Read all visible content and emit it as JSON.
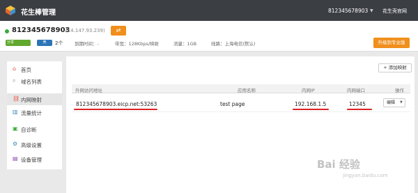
{
  "header": {
    "app_title": "花生棒管理",
    "user_id": "812345678903",
    "caret": "▼",
    "site_link": "花生壳官网"
  },
  "device": {
    "domain": "812345678903",
    "ip": "(14.147.93.239)",
    "swap_glyph": "⇄",
    "badge_green": "分享",
    "badge_blue": "壳",
    "count": "2个",
    "expire": "到期时间：-",
    "bandwidth": "带宽：128Kbps/映射",
    "traffic": "流量：1GB",
    "line": "线路：上海电信(默认)",
    "upgrade_label": "升级到专业版"
  },
  "sidebar": {
    "items": [
      {
        "label": "首页",
        "icon": "home-icon"
      },
      {
        "label": "域名列表",
        "icon": "search-icon"
      },
      {
        "label": "内网映射",
        "icon": "link-icon"
      },
      {
        "label": "流量统计",
        "icon": "chart-icon"
      },
      {
        "label": "自诊断",
        "icon": "kit-icon"
      },
      {
        "label": "高级设置",
        "icon": "gear-icon"
      },
      {
        "label": "设备管理",
        "icon": "device-icon"
      }
    ]
  },
  "main": {
    "add_label": "+ 添加映射",
    "columns": [
      "外网访问地址",
      "应用名称",
      "内网IP",
      "内网端口",
      "操作"
    ],
    "rows": [
      {
        "address": "812345678903.eicp.net:53263",
        "app": "test page",
        "ip": "192.168.1.5",
        "port": "12345",
        "action": "编辑"
      }
    ]
  },
  "watermark": {
    "text": "Bai 经验",
    "sub": "jingyan.baidu.com"
  },
  "colors": {
    "accent": "#f08f1c",
    "topbar": "#3b3e43",
    "online": "#3cab3c",
    "highlight": "#dd2222"
  }
}
